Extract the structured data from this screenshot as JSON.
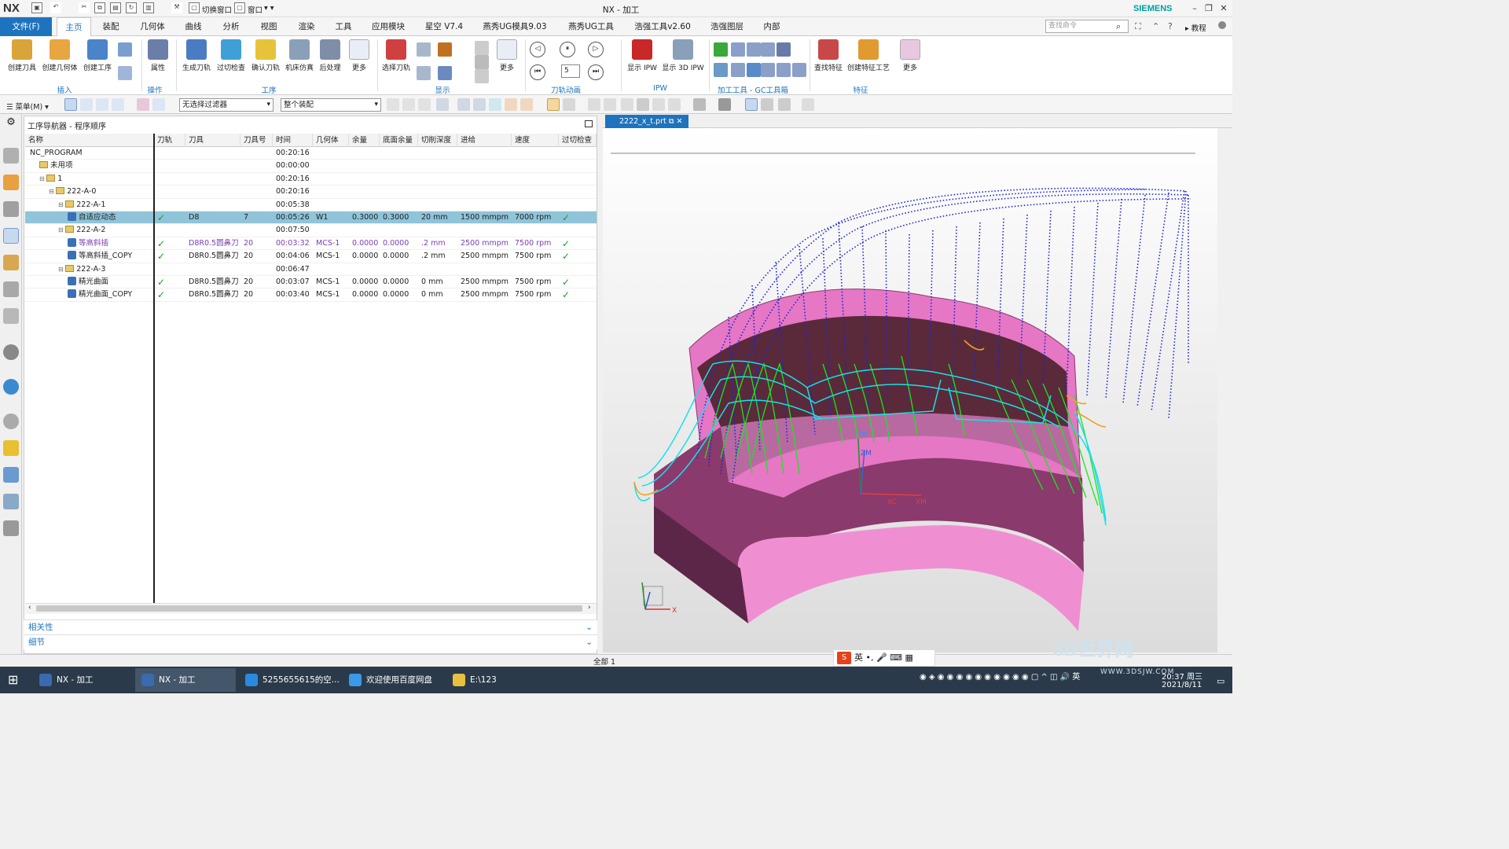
{
  "app": {
    "logo": "NX",
    "window_title": "NX - 加工",
    "brand": "SIEMENS",
    "switch_window": "切换窗口",
    "window_menu": "窗口",
    "tutorial": "教程"
  },
  "ribbon": {
    "file_tab": "文件(F)",
    "tabs": [
      "主页",
      "装配",
      "几何体",
      "曲线",
      "分析",
      "视图",
      "渲染",
      "工具",
      "应用模块",
      "星空 V7.4",
      "燕秀UG模具9.03",
      "燕秀UG工具",
      "浩强工具v2.60",
      "浩强图层",
      "内部"
    ],
    "search_placeholder": "查找命令",
    "insert": {
      "create_tool": "创建刀具",
      "create_geometry": "创建几何体",
      "create_operation": "创建工序",
      "group_label": "插入"
    },
    "operate": {
      "properties": "属性",
      "group_label": "操作"
    },
    "operation": {
      "generate": "生成刀轨",
      "gouge_check": "过切检查",
      "verify": "确认刀轨",
      "machine_sim": "机床仿真",
      "postprocess": "后处理",
      "more": "更多",
      "group_label": "工序"
    },
    "display": {
      "select_path": "选择刀轨",
      "more": "更多",
      "group_label": "显示"
    },
    "animation": {
      "speed": "5",
      "group_label": "刀轨动画"
    },
    "ipw": {
      "show_ipw": "显示 IPW",
      "show_3d_ipw": "显示 3D IPW",
      "group_label": "IPW"
    },
    "gc": {
      "group_label": "加工工具 - GC工具箱"
    },
    "feature": {
      "find_feature": "查找特征",
      "create_feature_process": "创建特征工艺",
      "more": "更多",
      "group_label": "特征"
    }
  },
  "selection_bar": {
    "menu": "菜单(M)",
    "filter": "无选择过滤器",
    "scope": "整个装配"
  },
  "navigator": {
    "title": "工序导航器 - 程序顺序",
    "columns": [
      "名称",
      "刀轨",
      "刀具",
      "刀具号",
      "时间",
      "几何体",
      "余量",
      "底面余量",
      "切削深度",
      "进给",
      "速度",
      "过切检查"
    ],
    "rows": [
      {
        "indent": 0,
        "icon": "none",
        "name": "NC_PROGRAM",
        "time": "00:20:16"
      },
      {
        "indent": 1,
        "icon": "folder",
        "name": "未用项",
        "time": "00:00:00"
      },
      {
        "indent": 1,
        "icon": "folder",
        "toggle": "−",
        "name": "1",
        "time": "00:20:16"
      },
      {
        "indent": 2,
        "icon": "folder",
        "toggle": "−",
        "name": "222-A-0",
        "time": "00:20:16"
      },
      {
        "indent": 3,
        "icon": "folder",
        "toggle": "−",
        "name": "222-A-1",
        "time": "00:05:38"
      },
      {
        "indent": 4,
        "icon": "op",
        "name": "自适应动态",
        "path": "✓",
        "tool": "D8",
        "tool_no": "7",
        "time": "00:05:26",
        "geometry": "W1",
        "stock": "0.3000",
        "floor_stock": "0.3000",
        "depth": "20 mm",
        "feed": "1500 mmpm",
        "speed": "7000 rpm",
        "gouge": "✓",
        "selected": true
      },
      {
        "indent": 3,
        "icon": "folder",
        "toggle": "−",
        "name": "222-A-2",
        "time": "00:07:50"
      },
      {
        "indent": 4,
        "icon": "op",
        "name": "等高斜插",
        "path": "✓",
        "tool": "D8R0.5圆鼻刀",
        "tool_no": "20",
        "time": "00:03:32",
        "geometry": "MCS-1",
        "stock": "0.0000",
        "floor_stock": "0.0000",
        "depth": ".2 mm",
        "feed": "2500 mmpm",
        "speed": "7500 rpm",
        "gouge": "✓",
        "purple": true
      },
      {
        "indent": 4,
        "icon": "op",
        "name": "等高斜插_COPY",
        "path": "✓",
        "tool": "D8R0.5圆鼻刀",
        "tool_no": "20",
        "time": "00:04:06",
        "geometry": "MCS-1",
        "stock": "0.0000",
        "floor_stock": "0.0000",
        "depth": ".2 mm",
        "feed": "2500 mmpm",
        "speed": "7500 rpm",
        "gouge": "✓"
      },
      {
        "indent": 3,
        "icon": "folder",
        "toggle": "−",
        "name": "222-A-3",
        "time": "00:06:47"
      },
      {
        "indent": 4,
        "icon": "op",
        "name": "精光曲面",
        "path": "✓",
        "tool": "D8R0.5圆鼻刀",
        "tool_no": "20",
        "time": "00:03:07",
        "geometry": "MCS-1",
        "stock": "0.0000",
        "floor_stock": "0.0000",
        "depth": "0 mm",
        "feed": "2500 mmpm",
        "speed": "7500 rpm",
        "gouge": "✓"
      },
      {
        "indent": 4,
        "icon": "op",
        "name": "精光曲面_COPY",
        "path": "✓",
        "tool": "D8R0.5圆鼻刀",
        "tool_no": "20",
        "time": "00:03:40",
        "geometry": "MCS-1",
        "stock": "0.0000",
        "floor_stock": "0.0000",
        "depth": "0 mm",
        "feed": "2500 mmpm",
        "speed": "7500 rpm",
        "gouge": "✓"
      }
    ],
    "dependencies": "相关性",
    "details": "细节"
  },
  "graphics": {
    "tab": "2222_x_t.prt",
    "axis": {
      "ym": "YM",
      "zm": "ZM",
      "xc": "XC",
      "xm": "XM",
      "x": "X"
    }
  },
  "status": {
    "text": "全部 1"
  },
  "ime": {
    "lang": "英"
  },
  "taskbar": {
    "items": [
      "NX - 加工",
      "NX - 加工",
      "5255655615的空...",
      "欢迎使用百度网盘",
      "E:\\123"
    ],
    "tray_lang": "英",
    "time": "20:37 周三",
    "date": "2021/8/11"
  },
  "watermark": {
    "text": "3D世界网",
    "url": "WWW.3DSJW.COM"
  },
  "colors": {
    "accent": "#1e73be",
    "part": "#e77fc8",
    "toolpath_blue": "#1a1ad8",
    "toolpath_green": "#18e818",
    "toolpath_cyan": "#18e0e8"
  }
}
